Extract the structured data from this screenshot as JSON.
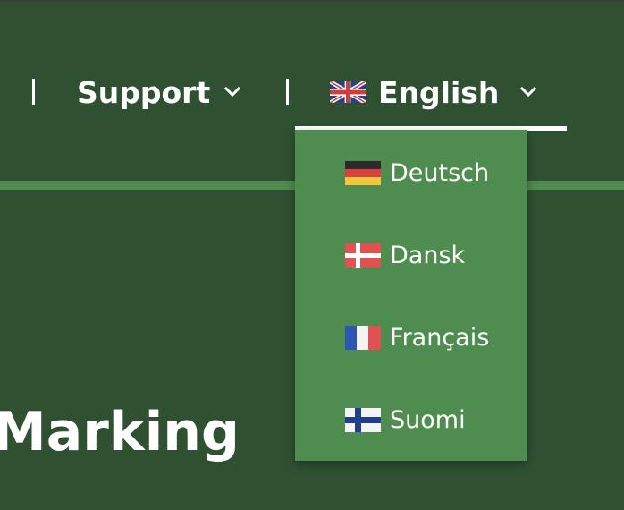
{
  "nav": {
    "items": [
      {
        "label": "Support"
      },
      {
        "label": "English"
      }
    ]
  },
  "language_menu": {
    "selected": "English",
    "options": [
      {
        "label": "Deutsch"
      },
      {
        "label": "Dansk"
      },
      {
        "label": "Français"
      },
      {
        "label": "Suomi"
      }
    ]
  },
  "page": {
    "title": "Marking"
  },
  "colors": {
    "background": "#2f5132",
    "accent_green": "#4f8c4f",
    "text": "#ffffff"
  },
  "icons": {
    "support_chevron": "chevron-down-icon",
    "language_chevron": "chevron-down-icon",
    "english_flag": "uk-flag-icon",
    "deutsch_flag": "germany-flag-icon",
    "dansk_flag": "denmark-flag-icon",
    "francais_flag": "france-flag-icon",
    "suomi_flag": "finland-flag-icon"
  }
}
